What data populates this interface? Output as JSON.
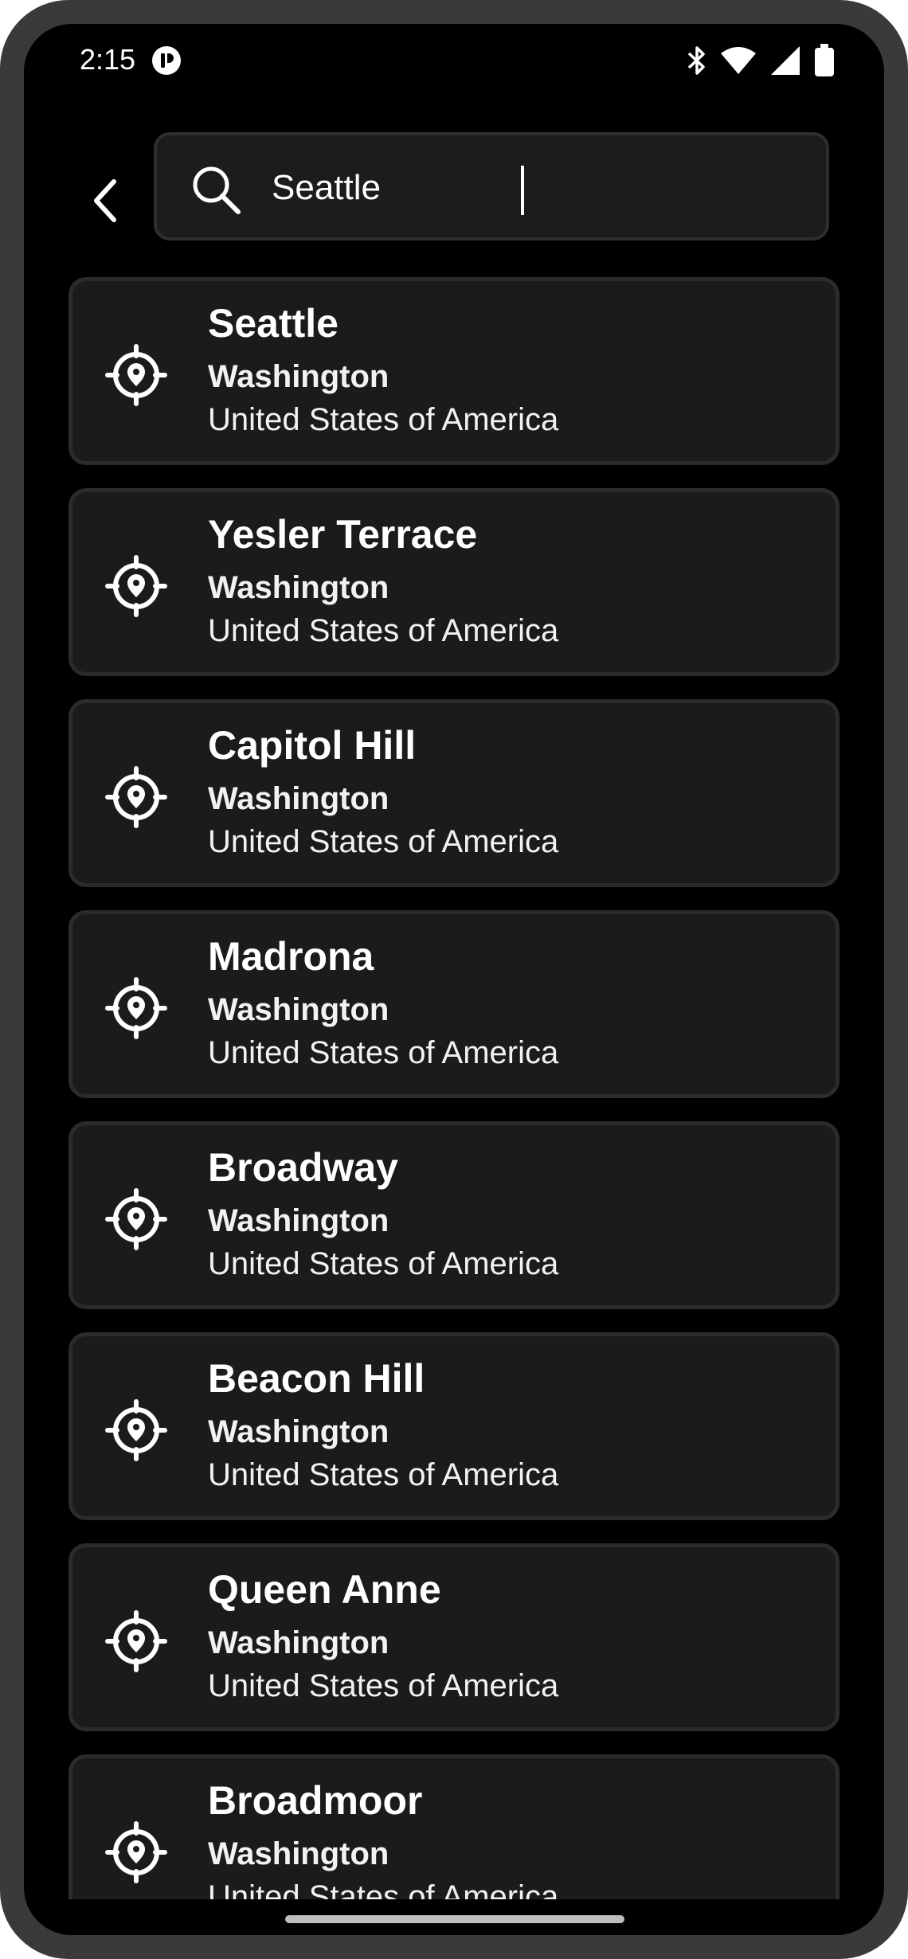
{
  "status_bar": {
    "time": "2:15",
    "icons": [
      "bluetooth-icon",
      "wifi-icon",
      "cell-signal-icon",
      "battery-icon"
    ]
  },
  "search": {
    "query": "Seattle",
    "placeholder": ""
  },
  "colors": {
    "background": "#000000",
    "card_background": "#1b1b1b",
    "card_border": "#2b2b2b",
    "text": "#ffffff"
  },
  "results": [
    {
      "name": "Seattle",
      "region": "Washington",
      "country": "United States of America"
    },
    {
      "name": "Yesler Terrace",
      "region": "Washington",
      "country": "United States of America"
    },
    {
      "name": "Capitol Hill",
      "region": "Washington",
      "country": "United States of America"
    },
    {
      "name": "Madrona",
      "region": "Washington",
      "country": "United States of America"
    },
    {
      "name": "Broadway",
      "region": "Washington",
      "country": "United States of America"
    },
    {
      "name": "Beacon Hill",
      "region": "Washington",
      "country": "United States of America"
    },
    {
      "name": "Queen Anne",
      "region": "Washington",
      "country": "United States of America"
    },
    {
      "name": "Broadmoor",
      "region": "Washington",
      "country": "United States of America"
    }
  ]
}
